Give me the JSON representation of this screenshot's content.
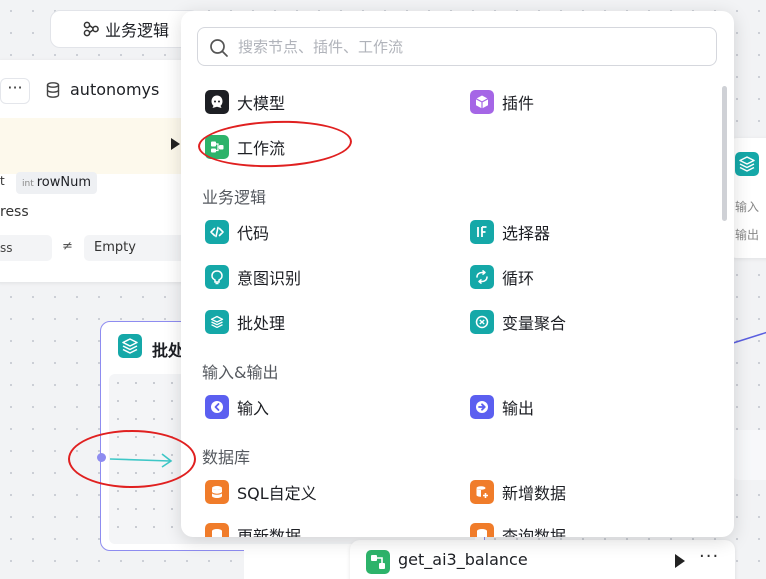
{
  "top_tab": {
    "label": "业务逻辑"
  },
  "left_node": {
    "more": "···",
    "name": "autonomys",
    "param_type_short": "t",
    "param_tag_type": "int",
    "param_tag_name": "rowNum",
    "address_fragment": "ress",
    "left_value": "ss",
    "operator": "≠",
    "right_value": "Empty"
  },
  "batch_node": {
    "title": "批处"
  },
  "right_node": {
    "input_label": "输入",
    "output_label": "输出"
  },
  "bottom_node": {
    "title": "get_ai3_balance",
    "more": "···"
  },
  "popup": {
    "search_placeholder": "搜索节点、插件、工作流",
    "top_items": [
      {
        "label": "大模型",
        "icon": "llm-icon",
        "color": "#1d1f24"
      },
      {
        "label": "插件",
        "icon": "plugin-icon",
        "color": "#a566e6"
      },
      {
        "label": "工作流",
        "icon": "workflow-icon",
        "color": "#2db36a"
      }
    ],
    "sections": [
      {
        "title": "业务逻辑",
        "items": [
          {
            "label": "代码",
            "icon": "code-icon",
            "color": "#15a8a8"
          },
          {
            "label": "选择器",
            "icon": "if-selector-icon",
            "color": "#15a8a8"
          },
          {
            "label": "意图识别",
            "icon": "intent-icon",
            "color": "#15a8a8"
          },
          {
            "label": "循环",
            "icon": "loop-icon",
            "color": "#15a8a8"
          },
          {
            "label": "批处理",
            "icon": "batch-icon",
            "color": "#15a8a8"
          },
          {
            "label": "变量聚合",
            "icon": "variable-aggregate-icon",
            "color": "#15a8a8"
          }
        ]
      },
      {
        "title": "输入&输出",
        "items": [
          {
            "label": "输入",
            "icon": "input-icon",
            "color": "#5b5ff0"
          },
          {
            "label": "输出",
            "icon": "output-icon",
            "color": "#5b5ff0"
          }
        ]
      },
      {
        "title": "数据库",
        "items": [
          {
            "label": "SQL自定义",
            "icon": "sql-icon",
            "color": "#f07c2a"
          },
          {
            "label": "新增数据",
            "icon": "add-data-icon",
            "color": "#f07c2a"
          },
          {
            "label": "更新数据",
            "icon": "update-data-icon",
            "color": "#f07c2a"
          },
          {
            "label": "查询数据",
            "icon": "query-data-icon",
            "color": "#f07c2a"
          }
        ]
      }
    ]
  },
  "colors": {
    "accent_teal": "#15a8a8",
    "accent_purple": "#a566e6",
    "accent_green": "#2db36a",
    "accent_indigo": "#5b5ff0",
    "accent_orange": "#f07c2a",
    "annotation_red": "#e02020",
    "edge_blue": "#5b5fe0"
  }
}
